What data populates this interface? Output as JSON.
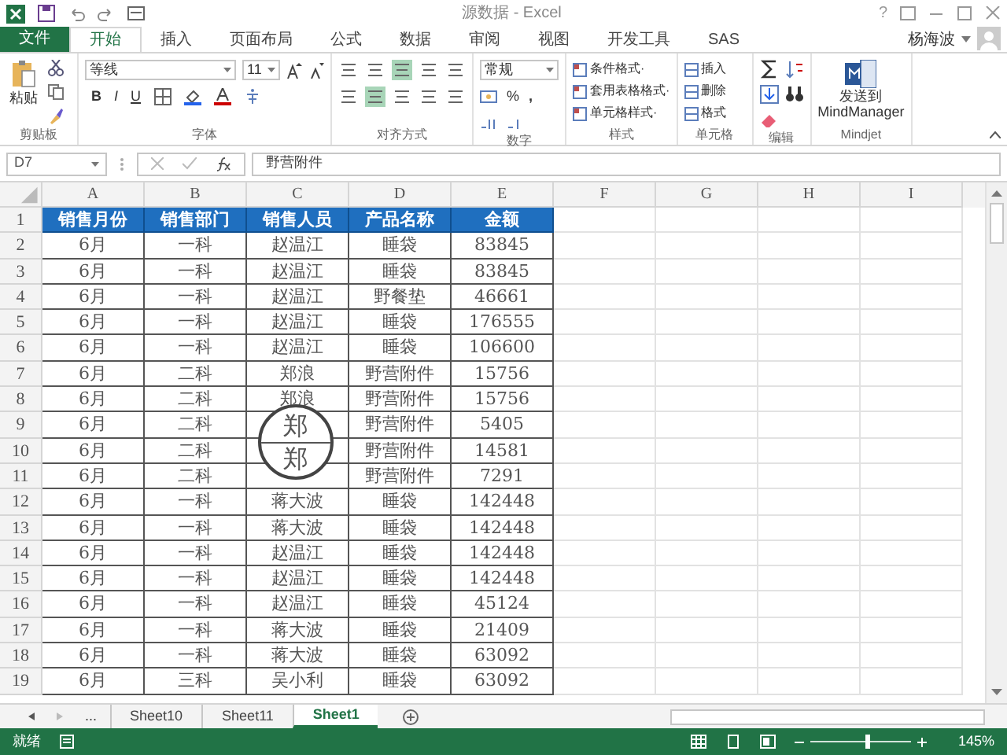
{
  "window": {
    "title": "源数据 - Excel",
    "help": "?",
    "user": "杨海波"
  },
  "tabs": [
    {
      "label": "文件",
      "kind": "file",
      "selected": false
    },
    {
      "label": "开始",
      "kind": "tab",
      "selected": true
    },
    {
      "label": "插入",
      "kind": "tab",
      "selected": false
    },
    {
      "label": "页面布局",
      "kind": "tab",
      "selected": false
    },
    {
      "label": "公式",
      "kind": "tab",
      "selected": false
    },
    {
      "label": "数据",
      "kind": "tab",
      "selected": false
    },
    {
      "label": "审阅",
      "kind": "tab",
      "selected": false
    },
    {
      "label": "视图",
      "kind": "tab",
      "selected": false
    },
    {
      "label": "开发工具",
      "kind": "tab",
      "selected": false
    },
    {
      "label": "SAS",
      "kind": "tab",
      "selected": false
    }
  ],
  "ribbon": {
    "paste": "粘贴",
    "font_name": "等线",
    "font_size": "11",
    "bold": "B",
    "italic": "I",
    "underline": "U",
    "number_format": "常规",
    "percent": "%",
    "comma": ",",
    "styles": [
      "条件格式·",
      "套用表格格式·",
      "单元格样式·"
    ],
    "cells": [
      "插入",
      "删除",
      "格式"
    ],
    "send_to": "发送到",
    "mindmanager": "MindManager",
    "groups": [
      "剪贴板",
      "字体",
      "对齐方式",
      "数字",
      "样式",
      "单元格",
      "编辑",
      "Mindjet"
    ]
  },
  "formula_bar": {
    "name_box": "D7",
    "formula": "野营附件"
  },
  "columns": [
    "A",
    "B",
    "C",
    "D",
    "E",
    "F",
    "G",
    "H",
    "I"
  ],
  "rows": [
    {
      "num": "1",
      "cells": [
        "销售月份",
        "销售部门",
        "销售人员",
        "产品名称",
        "金额"
      ]
    },
    {
      "num": "2",
      "cells": [
        "6月",
        "一科",
        "赵温江",
        "睡袋",
        "83845"
      ]
    },
    {
      "num": "3",
      "cells": [
        "6月",
        "一科",
        "赵温江",
        "睡袋",
        "83845"
      ]
    },
    {
      "num": "4",
      "cells": [
        "6月",
        "一科",
        "赵温江",
        "野餐垫",
        "46661"
      ]
    },
    {
      "num": "5",
      "cells": [
        "6月",
        "一科",
        "赵温江",
        "睡袋",
        "176555"
      ]
    },
    {
      "num": "6",
      "cells": [
        "6月",
        "一科",
        "赵温江",
        "睡袋",
        "106600"
      ]
    },
    {
      "num": "7",
      "cells": [
        "6月",
        "二科",
        "郑浪",
        "野营附件",
        "15756"
      ]
    },
    {
      "num": "8",
      "cells": [
        "6月",
        "二科",
        "郑浪",
        "野营附件",
        "15756"
      ]
    },
    {
      "num": "9",
      "cells": [
        "6月",
        "二科",
        "",
        "野营附件",
        "5405"
      ]
    },
    {
      "num": "10",
      "cells": [
        "6月",
        "二科",
        "",
        "野营附件",
        "14581"
      ]
    },
    {
      "num": "11",
      "cells": [
        "6月",
        "二科",
        "",
        "野营附件",
        "7291"
      ]
    },
    {
      "num": "12",
      "cells": [
        "6月",
        "一科",
        "蒋大波",
        "睡袋",
        "142448"
      ]
    },
    {
      "num": "13",
      "cells": [
        "6月",
        "一科",
        "蒋大波",
        "睡袋",
        "142448"
      ]
    },
    {
      "num": "14",
      "cells": [
        "6月",
        "一科",
        "赵温江",
        "睡袋",
        "142448"
      ]
    },
    {
      "num": "15",
      "cells": [
        "6月",
        "一科",
        "赵温江",
        "睡袋",
        "142448"
      ]
    },
    {
      "num": "16",
      "cells": [
        "6月",
        "一科",
        "赵温江",
        "睡袋",
        "45124"
      ]
    },
    {
      "num": "17",
      "cells": [
        "6月",
        "一科",
        "蒋大波",
        "睡袋",
        "21409"
      ]
    },
    {
      "num": "18",
      "cells": [
        "6月",
        "一科",
        "蒋大波",
        "睡袋",
        "63092"
      ]
    },
    {
      "num": "19",
      "cells": [
        "6月",
        "三科",
        "吴小利",
        "睡袋",
        "63092"
      ]
    }
  ],
  "magnifier": {
    "texts": [
      "郑",
      "郑"
    ]
  },
  "sheet_tabs": {
    "more": "...",
    "tabs": [
      {
        "label": "Sheet10",
        "selected": false
      },
      {
        "label": "Sheet11",
        "selected": false
      },
      {
        "label": "Sheet1",
        "selected": true
      }
    ]
  },
  "status_bar": {
    "status": "就绪",
    "zoom_slider": {
      "level": 0.57
    },
    "zoom": "145%"
  }
}
